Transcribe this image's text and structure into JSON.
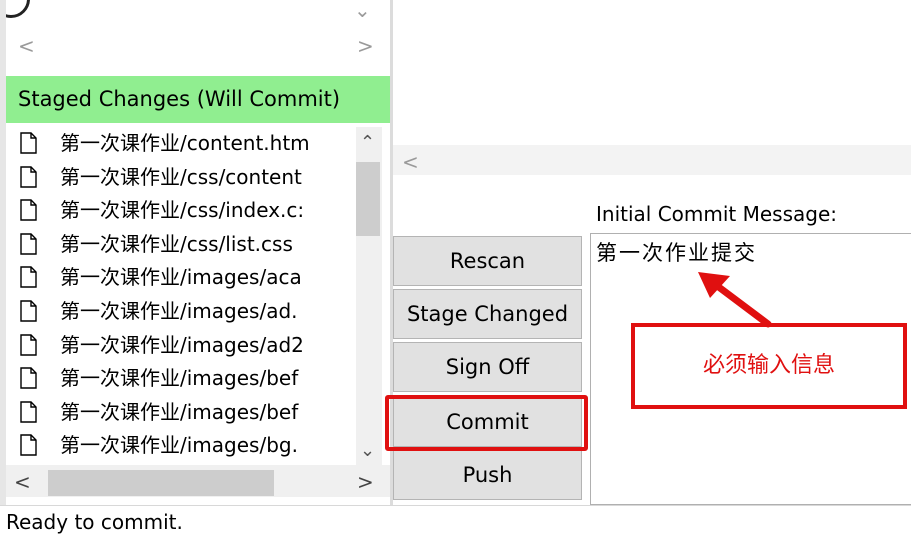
{
  "left_panel": {
    "staged_header": "Staged Changes (Will Commit)",
    "files": [
      "第一次课作业/content.htm",
      "第一次课作业/css/content",
      "第一次课作业/css/index.c:",
      "第一次课作业/css/list.css",
      "第一次课作业/images/aca",
      "第一次课作业/images/ad.",
      "第一次课作业/images/ad2",
      "第一次课作业/images/bef",
      "第一次课作业/images/bef",
      "第一次课作业/images/bg."
    ]
  },
  "commit_panel": {
    "message_label": "Initial Commit Message:",
    "message_text": "第一次作业提交",
    "buttons": {
      "rescan": "Rescan",
      "stage_changed": "Stage Changed",
      "sign_off": "Sign Off",
      "commit": "Commit",
      "push": "Push"
    }
  },
  "annotation": {
    "text": "必须输入信息",
    "color": "#e01010"
  },
  "status_bar": {
    "text": "Ready to commit."
  },
  "colors": {
    "staged_header_bg": "#90ee90",
    "button_bg": "#e1e1e1",
    "highlight_red": "#e01010"
  },
  "icons": {
    "file": "file-icon",
    "scroll_left": "chevron-left-icon",
    "scroll_right": "chevron-right-icon",
    "scroll_up": "chevron-up-icon",
    "scroll_down": "chevron-down-icon"
  }
}
